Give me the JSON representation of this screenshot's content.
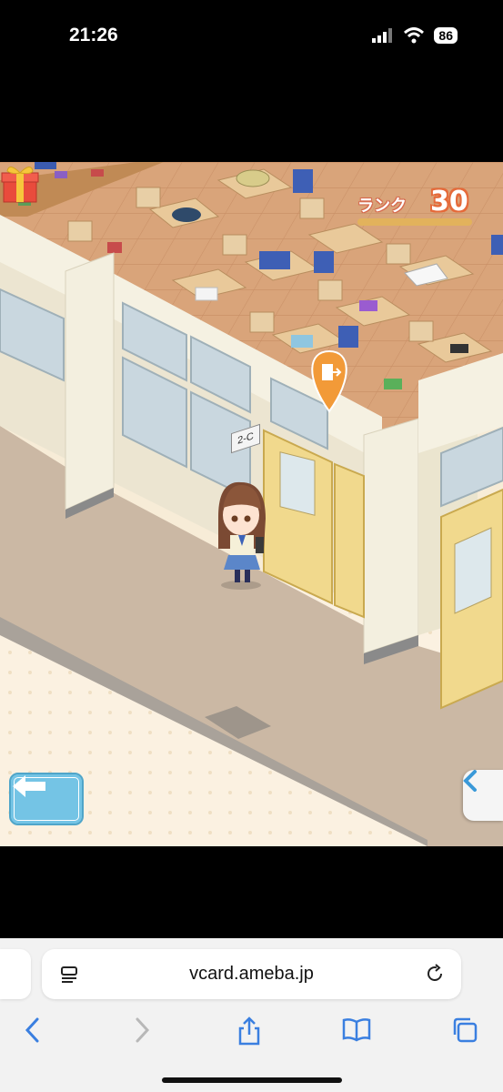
{
  "status_bar": {
    "time": "21:26",
    "battery": "86"
  },
  "game": {
    "rank_label": "ランク",
    "rank_value": "30",
    "room_sign": "2-C"
  },
  "browser": {
    "url": "vcard.ameba.jp"
  },
  "colors": {
    "floor_tile": "#d9a47a",
    "wall": "#efe9d6",
    "corridor": "#cbb8a4",
    "door": "#f1d98d",
    "accent_orange": "#f29a38",
    "back_button": "#74c4e5",
    "ios_blue": "#3a7fe0"
  }
}
